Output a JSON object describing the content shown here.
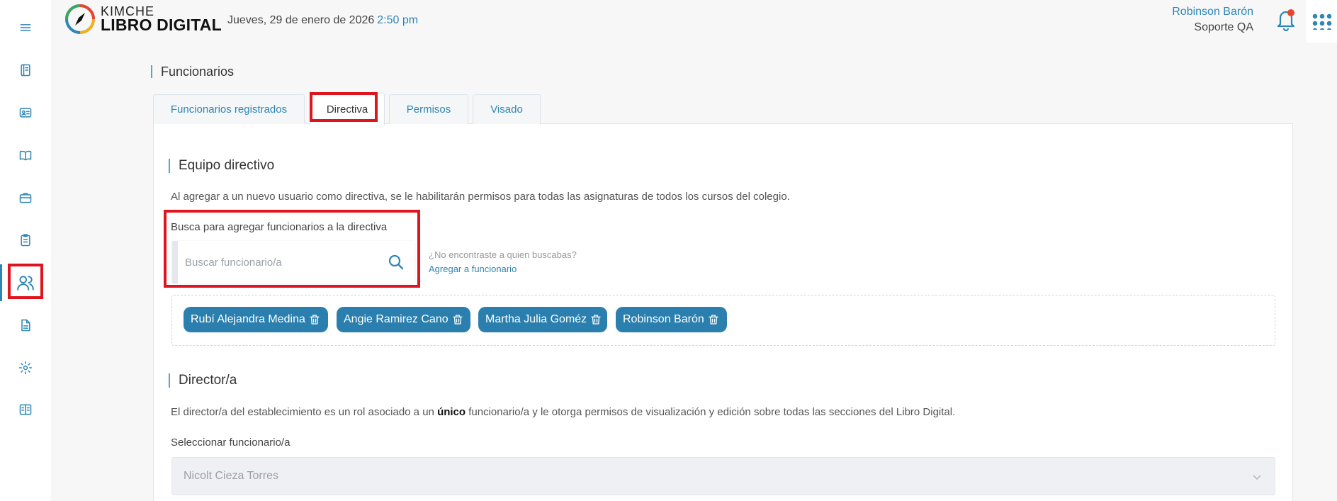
{
  "header": {
    "brand_top": "KIMCHE",
    "brand_bottom": "LIBRO DIGITAL",
    "date": "Jueves, 29 de enero de 2026",
    "time": "2:50 pm",
    "user_name": "Robinson Barón",
    "user_role": "Soporte QA"
  },
  "sidebar": {
    "items": [
      {
        "icon": "menu-icon"
      },
      {
        "icon": "notebook-icon"
      },
      {
        "icon": "id-card-icon"
      },
      {
        "icon": "open-book-icon"
      },
      {
        "icon": "briefcase-icon"
      },
      {
        "icon": "clipboard-icon"
      },
      {
        "icon": "users-icon",
        "active": true
      },
      {
        "icon": "document-icon"
      },
      {
        "icon": "gear-icon"
      },
      {
        "icon": "reader-icon"
      }
    ]
  },
  "page": {
    "title": "Funcionarios",
    "tabs": [
      {
        "label": "Funcionarios registrados"
      },
      {
        "label": "Directiva",
        "active": true
      },
      {
        "label": "Permisos"
      },
      {
        "label": "Visado"
      }
    ]
  },
  "equipo": {
    "title": "Equipo directivo",
    "description": "Al agregar a un nuevo usuario como directiva, se le habilitarán permisos para todas las asignaturas de todos los cursos del colegio.",
    "search_label": "Busca para agregar funcionarios a la directiva",
    "search_placeholder": "Buscar funcionario/a",
    "hint": "¿No encontraste a quien buscabas?",
    "hint_link": "Agregar a funcionario",
    "members": [
      "Rubí Alejandra Medina",
      "Angie Ramirez Cano",
      "Martha Julia Goméz",
      "Robinson Barón"
    ]
  },
  "director": {
    "title": "Director/a",
    "description_pre": "El director/a del establecimiento es un rol asociado a un ",
    "description_bold": "único",
    "description_post": " funcionario/a y le otorga permisos de visualización y edición sobre todas las secciones del Libro Digital.",
    "select_label": "Seleccionar funcionario/a",
    "select_value": "Nicolt Cieza Torres"
  },
  "colors": {
    "accent": "#2e86b5",
    "chip": "#2b7fae",
    "highlight": "#e0141e"
  }
}
